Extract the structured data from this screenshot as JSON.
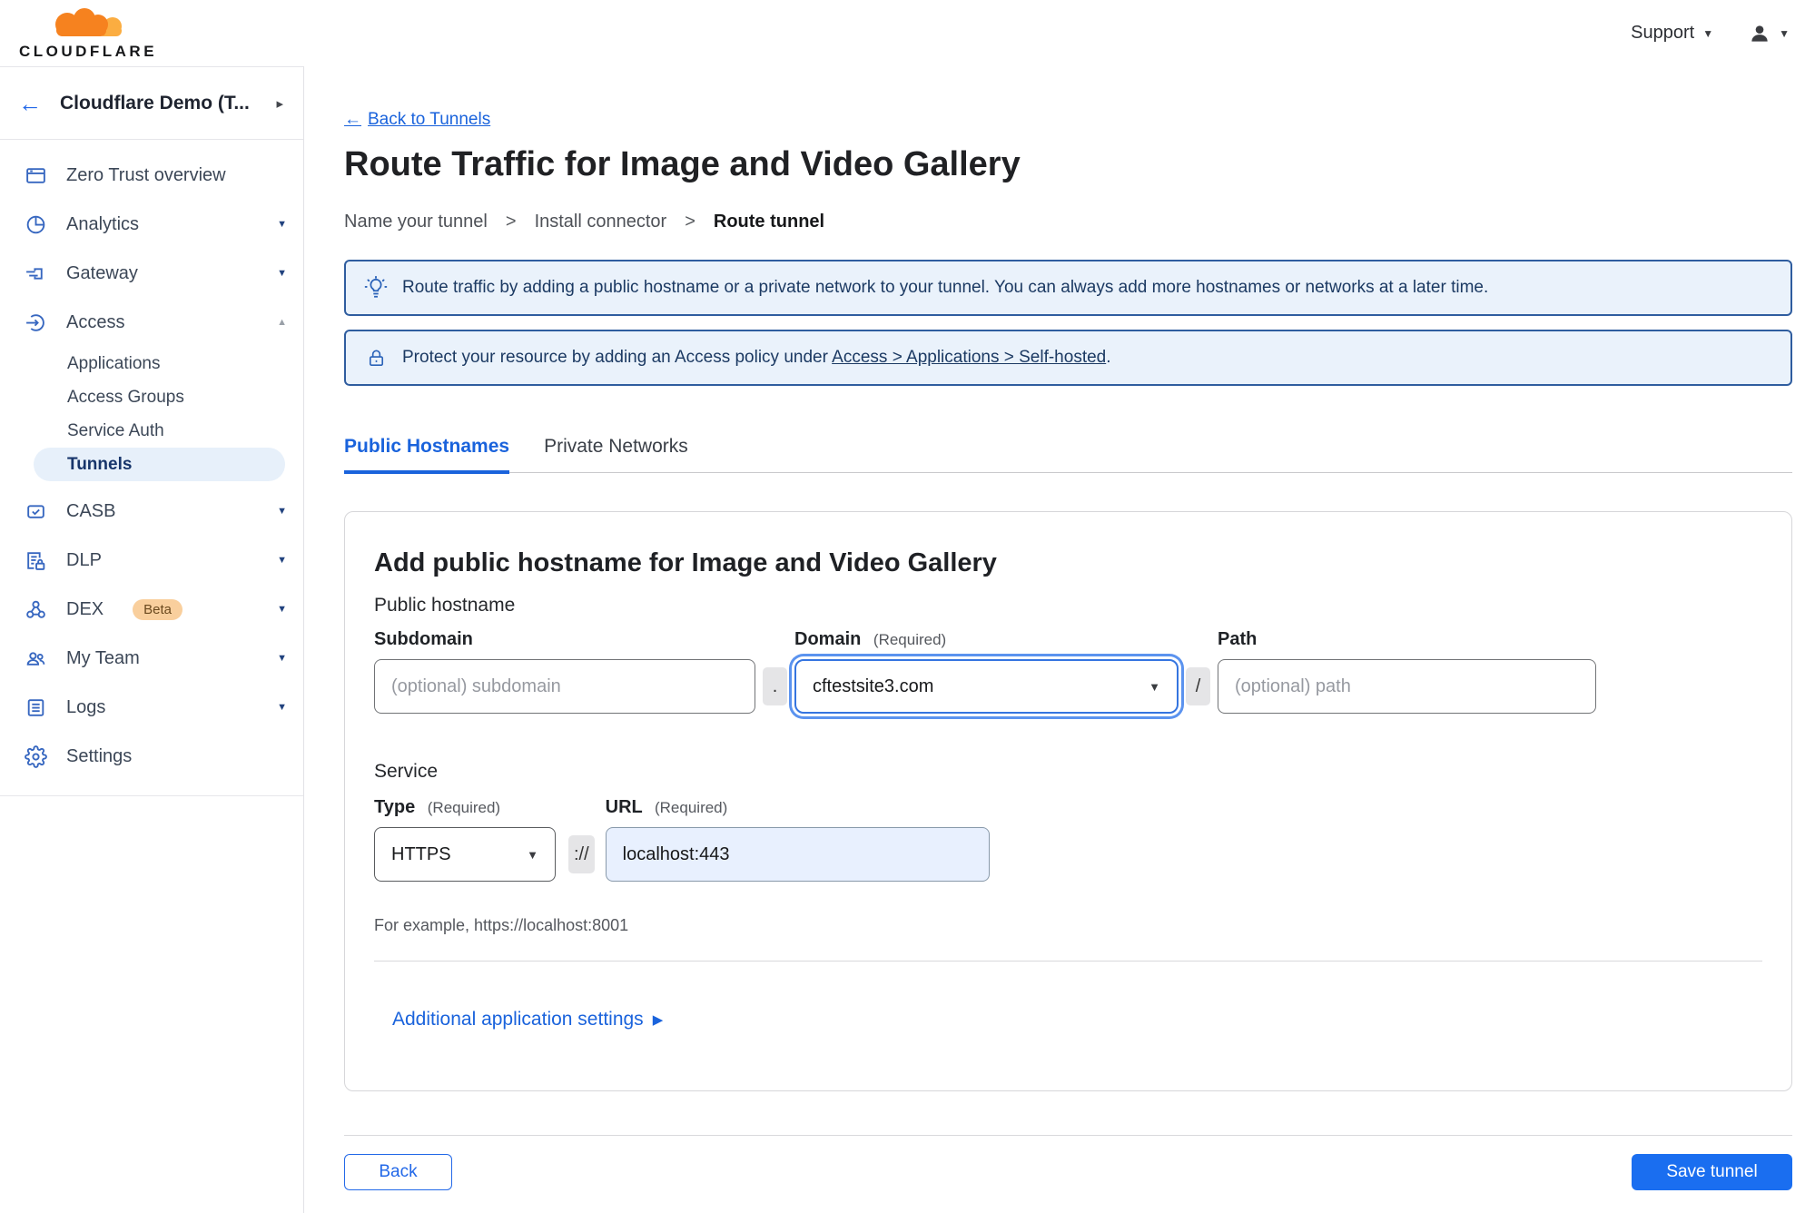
{
  "brand": {
    "word": "CLOUDFLARE"
  },
  "topbar": {
    "support_label": "Support"
  },
  "icons": {
    "back_arrow": "←",
    "chevron_down": "▼",
    "chevron_up": "▲",
    "chevron_right": "▸",
    "disclosure_right": "▶",
    "dropdown_arrow": "▼"
  },
  "sidebar": {
    "account_name": "Cloudflare Demo (T...",
    "items": [
      {
        "label": "Zero Trust overview"
      },
      {
        "label": "Analytics"
      },
      {
        "label": "Gateway"
      },
      {
        "label": "Access"
      },
      {
        "label": "Applications"
      },
      {
        "label": "Access Groups"
      },
      {
        "label": "Service Auth"
      },
      {
        "label": "Tunnels"
      },
      {
        "label": "CASB"
      },
      {
        "label": "DLP"
      },
      {
        "label": "DEX",
        "badge": "Beta"
      },
      {
        "label": "My Team"
      },
      {
        "label": "Logs"
      },
      {
        "label": "Settings"
      }
    ]
  },
  "page": {
    "back_link": "Back to Tunnels",
    "title": "Route Traffic for Image and Video Gallery",
    "steps": [
      "Name your tunnel",
      "Install connector",
      "Route tunnel"
    ],
    "step_separator": ">",
    "banner_tip": "Route traffic by adding a public hostname or a private network to your tunnel. You can always add more hostnames or networks at a later time.",
    "banner_protect_before": "Protect your resource by adding an Access policy under",
    "banner_protect_link": "Access > Applications > Self-hosted",
    "banner_protect_after": ".",
    "tabs": [
      {
        "label": "Public Hostnames"
      },
      {
        "label": "Private Networks"
      }
    ]
  },
  "form": {
    "heading": "Add public hostname for Image and Video Gallery",
    "public_hostname_label": "Public hostname",
    "subdomain_label": "Subdomain",
    "subdomain_placeholder": "(optional) subdomain",
    "dot_separator": ".",
    "domain_label": "Domain",
    "required_hint": "(Required)",
    "domain_value": "cftestsite3.com",
    "slash_separator": "/",
    "path_label": "Path",
    "path_placeholder": "(optional) path",
    "service_label": "Service",
    "type_label": "Type",
    "type_value": "HTTPS",
    "scheme_separator": "://",
    "url_label": "URL",
    "url_value": "localhost:443",
    "example_hint": "For example, https://localhost:8001",
    "additional_settings_label": "Additional application settings"
  },
  "footer": {
    "back_label": "Back",
    "save_label": "Save tunnel"
  },
  "colors": {
    "accent_blue": "#1a6ef0",
    "link_blue": "#1a63dc",
    "banner_border": "#2f5d9f",
    "banner_bg": "#eaf2fb",
    "brand_orange": "#f6821f",
    "brand_orange_light": "#fbad41"
  }
}
